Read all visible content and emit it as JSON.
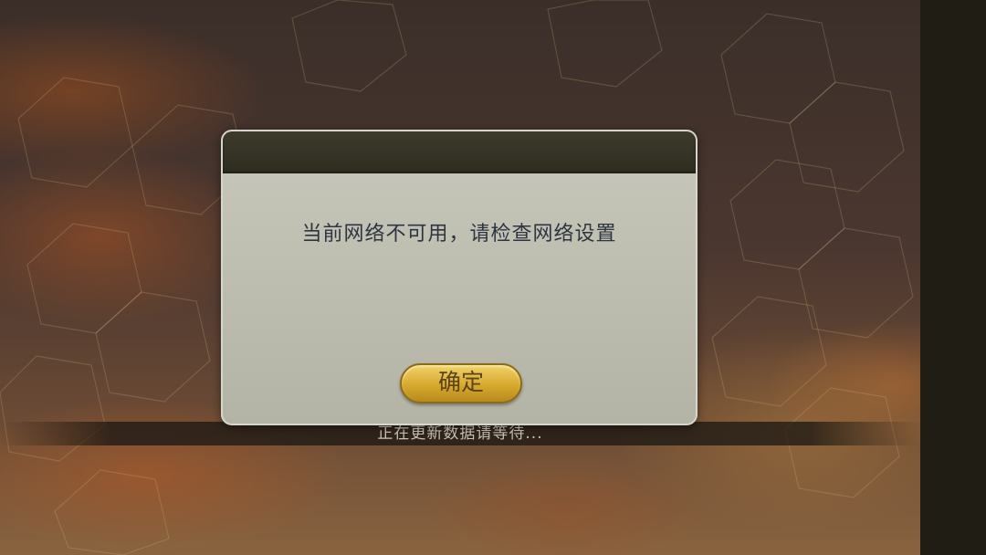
{
  "dialog": {
    "message": "当前网络不可用，请检查网络设置",
    "confirm_label": "确定"
  },
  "loading": {
    "status_text": "正在更新数据请等待..."
  },
  "colors": {
    "dialog_header": "#34332a",
    "dialog_body": "#bcbdaf",
    "confirm_button": "#dcae34",
    "side_bar": "#1f1d14"
  }
}
